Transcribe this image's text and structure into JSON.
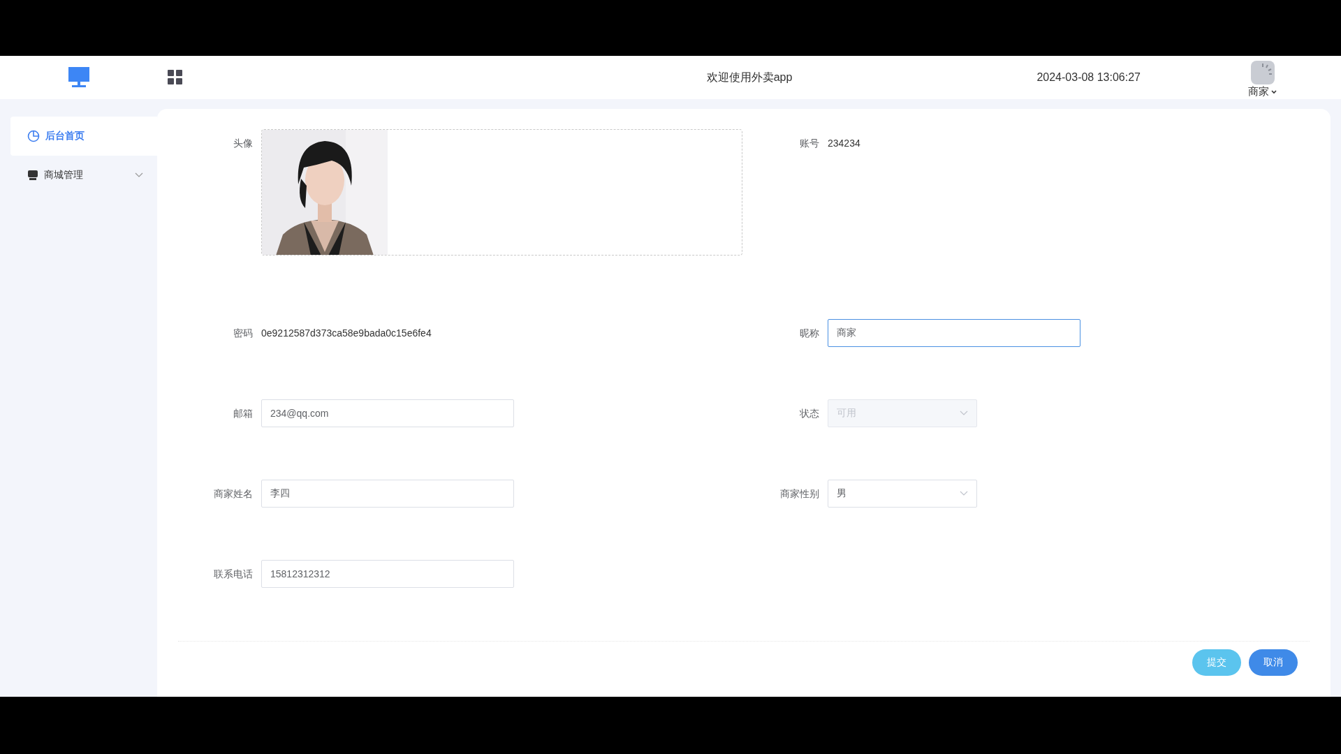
{
  "header": {
    "title": "欢迎使用外卖app",
    "datetime": "2024-03-08 13:06:27",
    "user_name": "商家"
  },
  "sidebar": {
    "items": [
      {
        "label": "后台首页",
        "kind": "home",
        "selected": true
      },
      {
        "label": "商城管理",
        "kind": "shop",
        "selected": false,
        "expanded": false
      }
    ]
  },
  "form": {
    "fields": [
      {
        "label": "头像",
        "kind": "avatar"
      },
      {
        "label": "账号",
        "kind": "text",
        "value": "234234"
      },
      {
        "label": "密码",
        "kind": "text",
        "value": "0e9212587d373ca58e9bada0c15e6fe4"
      },
      {
        "label": "昵称",
        "kind": "input",
        "value": "商家",
        "focused": true
      },
      {
        "label": "邮箱",
        "kind": "input",
        "value": "234@qq.com",
        "focused": false
      },
      {
        "label": "状态",
        "kind": "select",
        "value": "可用",
        "disabled": true
      },
      {
        "label": "商家姓名",
        "kind": "input",
        "value": "李四",
        "focused": false
      },
      {
        "label": "商家性别",
        "kind": "select",
        "value": "男",
        "disabled": false
      },
      {
        "label": "联系电话",
        "kind": "input",
        "value": "15812312312",
        "focused": false
      }
    ]
  },
  "buttons": [
    {
      "label": "提交",
      "color": "#5bc4ee"
    },
    {
      "label": "取消",
      "color": "#3f8ae8"
    }
  ]
}
